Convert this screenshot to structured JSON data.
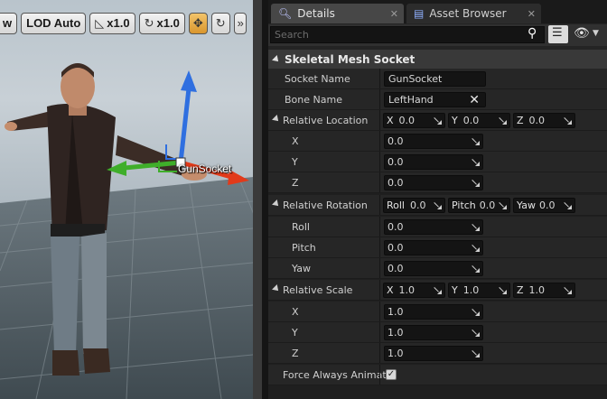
{
  "viewport": {
    "toolbar": {
      "view_label": "w",
      "lod_label": "LOD Auto",
      "fov_label": "x1.0",
      "speed_label": "x1.0"
    },
    "socket_label": "GunSocket"
  },
  "tabs": [
    {
      "label": "Details"
    },
    {
      "label": "Asset Browser"
    }
  ],
  "search": {
    "placeholder": "Search"
  },
  "category": {
    "title": "Skeletal Mesh Socket"
  },
  "props": {
    "socket_name": {
      "label": "Socket Name",
      "value": "GunSocket"
    },
    "bone_name": {
      "label": "Bone Name",
      "value": "LeftHand"
    },
    "rel_location": {
      "label": "Relative Location",
      "x_lbl": "X",
      "x": "0.0",
      "y_lbl": "Y",
      "y": "0.0",
      "z_lbl": "Z",
      "z": "0.0",
      "rows": [
        {
          "label": "X",
          "value": "0.0"
        },
        {
          "label": "Y",
          "value": "0.0"
        },
        {
          "label": "Z",
          "value": "0.0"
        }
      ]
    },
    "rel_rotation": {
      "label": "Relative Rotation",
      "roll_lbl": "Roll",
      "roll": "0.0",
      "pitch_lbl": "Pitch",
      "pitch": "0.0",
      "yaw_lbl": "Yaw",
      "yaw": "0.0",
      "rows": [
        {
          "label": "Roll",
          "value": "0.0"
        },
        {
          "label": "Pitch",
          "value": "0.0"
        },
        {
          "label": "Yaw",
          "value": "0.0"
        }
      ]
    },
    "rel_scale": {
      "label": "Relative Scale",
      "x_lbl": "X",
      "x": "1.0",
      "y_lbl": "Y",
      "y": "1.0",
      "z_lbl": "Z",
      "z": "1.0",
      "rows": [
        {
          "label": "X",
          "value": "1.0"
        },
        {
          "label": "Y",
          "value": "1.0"
        },
        {
          "label": "Z",
          "value": "1.0"
        }
      ]
    },
    "force_always_animated": {
      "label": "Force Always Animat",
      "checked": true
    }
  },
  "colors": {
    "gizmo_x": "#e23a1a",
    "gizmo_y": "#3fae2a",
    "gizmo_z": "#2f6fe0",
    "active_tool": "#e8a53a"
  }
}
